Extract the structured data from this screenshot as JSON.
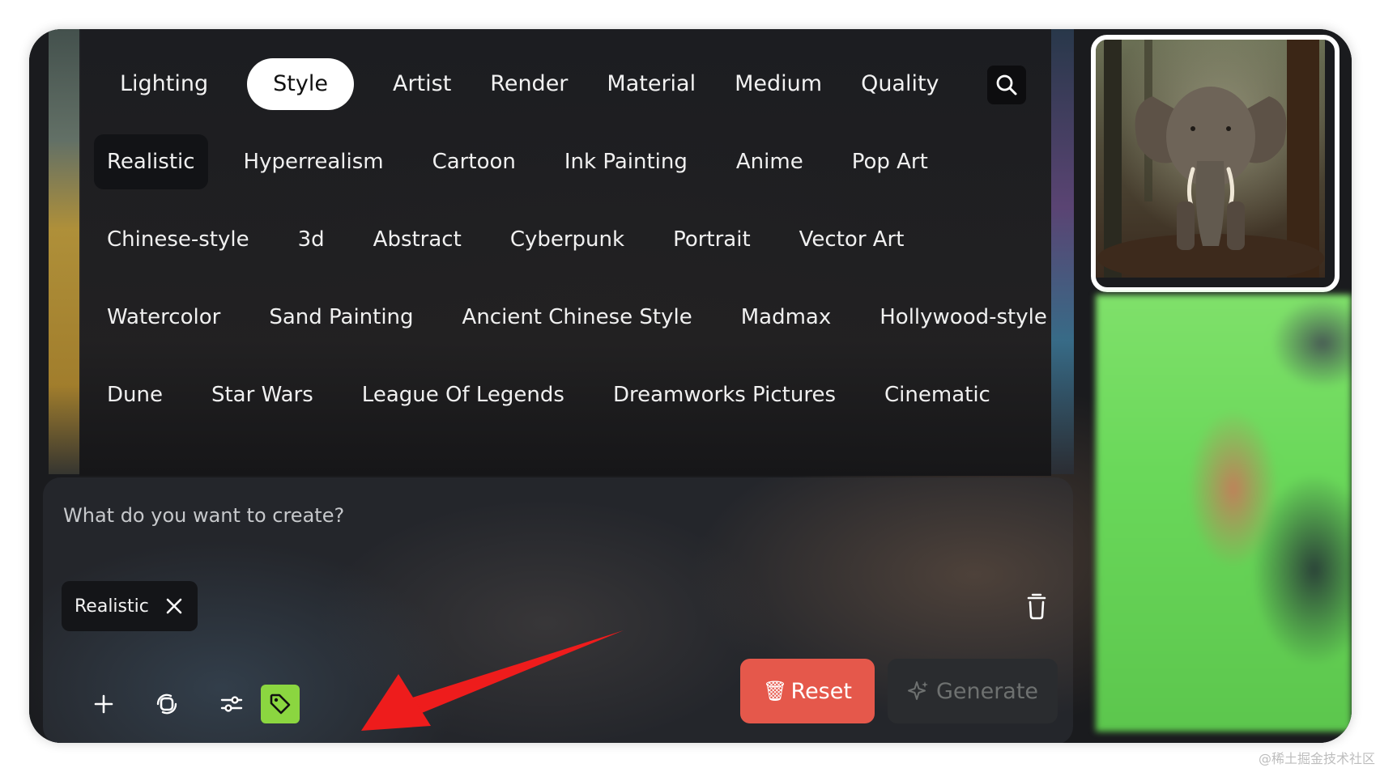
{
  "category_tabs": [
    {
      "label": "Lighting"
    },
    {
      "label": "Style",
      "active": true
    },
    {
      "label": "Artist"
    },
    {
      "label": "Render"
    },
    {
      "label": "Material"
    },
    {
      "label": "Medium"
    },
    {
      "label": "Quality"
    }
  ],
  "style_rows": [
    [
      "Realistic",
      "Hyperrealism",
      "Cartoon",
      "Ink Painting",
      "Anime",
      "Pop Art"
    ],
    [
      "Chinese-style",
      "3d",
      "Abstract",
      "Cyberpunk",
      "Portrait",
      "Vector Art"
    ],
    [
      "Watercolor",
      "Sand Painting",
      "Ancient Chinese Style",
      "Madmax",
      "Hollywood-style"
    ],
    [
      "Dune",
      "Star Wars",
      "League Of Legends",
      "Dreamworks Pictures",
      "Cinematic"
    ]
  ],
  "selected_style": "Realistic",
  "composer": {
    "placeholder": "What do you want to create?",
    "value": "",
    "tag_label": "Realistic",
    "reset_label": "Reset",
    "reset_icon": "🗑",
    "generate_label": "Generate"
  },
  "icons": {
    "search": "search-icon",
    "trash": "trash-icon",
    "add": "plus-icon",
    "rotate": "rotate-icon",
    "settings": "sliders-icon",
    "tag": "tag-icon",
    "sparkle": "sparkle-icon"
  },
  "colors": {
    "reset": "#e5584b",
    "tag_tool": "#8bd640",
    "arrow": "#ee1c1c"
  },
  "watermark": "@稀土掘金技术社区"
}
